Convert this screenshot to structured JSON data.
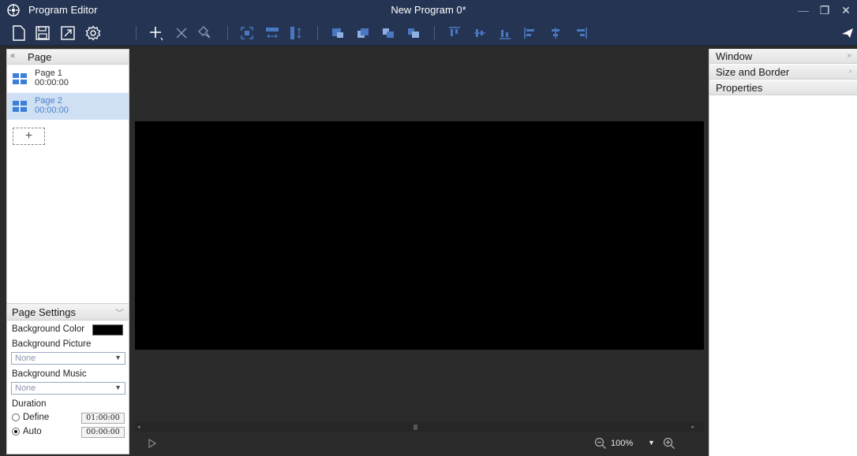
{
  "titlebar": {
    "app_title": "Program Editor",
    "document_title": "New Program 0*",
    "minimize_glyph": "—",
    "restore_glyph": "❐",
    "close_glyph": "✕"
  },
  "toolbar": {
    "icons": [
      "new-file-icon",
      "save-icon",
      "export-icon",
      "settings-icon",
      "add-window-icon",
      "delete-icon",
      "pin-icon",
      "fit-icon",
      "same-width-icon",
      "same-height-icon",
      "bring-front-icon",
      "send-back-icon",
      "forward-icon",
      "backward-icon",
      "align-top-icon",
      "align-middle-icon",
      "align-bottom-icon",
      "align-left-icon",
      "align-center-icon",
      "align-right-icon",
      "send-icon"
    ]
  },
  "page_panel": {
    "title": "Page",
    "collapse_glyph": "«",
    "pages": [
      {
        "name": "Page 1",
        "duration": "00:00:00",
        "selected": false
      },
      {
        "name": "Page 2",
        "duration": "00:00:00",
        "selected": true
      }
    ],
    "add_glyph": "+"
  },
  "page_settings": {
    "title": "Page Settings",
    "chevron_glyph": "﹀",
    "background_color_label": "Background Color",
    "background_color": "#000000",
    "background_picture_label": "Background Picture",
    "background_picture_value": "None",
    "background_music_label": "Background Music",
    "background_music_value": "None",
    "combo_arrow": "▼",
    "duration_label": "Duration",
    "define_label": "Define",
    "define_time": "01:00:00",
    "auto_label": "Auto",
    "auto_time": "00:00:00",
    "selected_duration": "Auto"
  },
  "canvas": {
    "zoom": "100%",
    "zoom_arrow": "▼",
    "scroll_left": "◂",
    "scroll_right": "▸"
  },
  "right_panel": {
    "window_label": "Window",
    "window_chevron": "»",
    "size_border_label": "Size and Border",
    "size_border_chevron": "›",
    "properties_label": "Properties"
  },
  "colors": {
    "titlebar_bg": "#243452",
    "canvas_bg": "#000000",
    "workspace_bg": "#2b2b2b",
    "selected_page_bg": "#cfe0f5",
    "accent_blue": "#4a90d9"
  }
}
